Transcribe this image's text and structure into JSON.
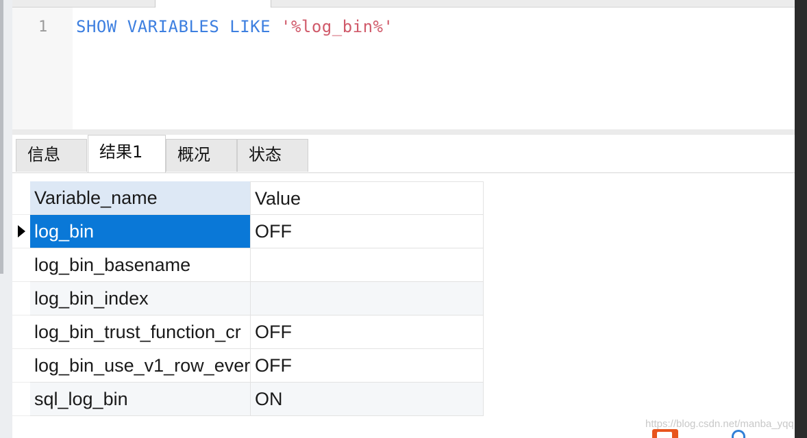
{
  "editor": {
    "line_number": "1",
    "sql": {
      "kw1": "SHOW",
      "kw2": "VARIABLES",
      "kw3": "LIKE",
      "literal": "'%log_bin%'"
    }
  },
  "result_tabs": [
    {
      "label": "信息",
      "active": false
    },
    {
      "label": "结果1",
      "active": true
    },
    {
      "label": "概况",
      "active": false
    },
    {
      "label": "状态",
      "active": false
    }
  ],
  "grid": {
    "columns": [
      "Variable_name",
      "Value"
    ],
    "rows": [
      {
        "name": "log_bin",
        "value": "OFF"
      },
      {
        "name": "log_bin_basename",
        "value": ""
      },
      {
        "name": "log_bin_index",
        "value": ""
      },
      {
        "name": "log_bin_trust_function_cr",
        "value": "OFF"
      },
      {
        "name": "log_bin_use_v1_row_ever",
        "value": "OFF"
      },
      {
        "name": "sql_log_bin",
        "value": "ON"
      }
    ],
    "selected_row": 0
  },
  "watermark": "https://blog.csdn.net/manba_yqq",
  "colors": {
    "keyword": "#3d7fe0",
    "string_literal": "#d05a6a",
    "selection": "#0a78d7",
    "header_highlight": "#dde8f5"
  }
}
